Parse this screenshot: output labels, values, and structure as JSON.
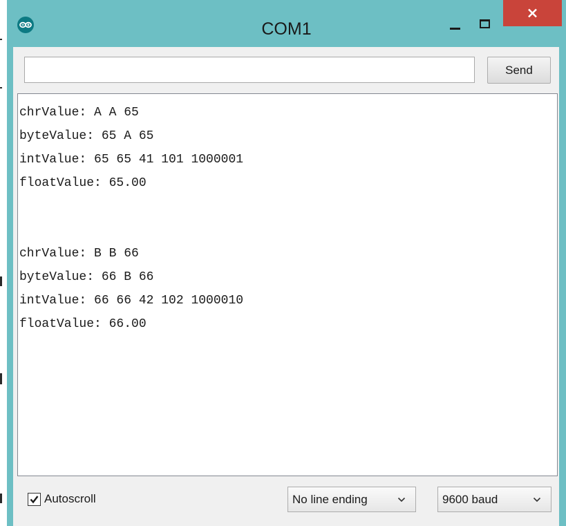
{
  "window": {
    "title": "COM1",
    "app_icon": "arduino-infinity-icon",
    "controls": [
      "minimize-icon",
      "maximize-icon",
      "close-icon"
    ],
    "accent_color": "#6dbfc4",
    "close_color": "#c9443a"
  },
  "send_bar": {
    "input_value": "",
    "send_label": "Send"
  },
  "output": {
    "lines": [
      "chrValue: A A 65",
      "byteValue: 65 A 65",
      "intValue: 65 65 41 101 1000001",
      "floatValue: 65.00",
      "",
      "",
      "chrValue: B B 66",
      "byteValue: 66 B 66",
      "intValue: 66 66 42 102 1000010",
      "floatValue: 66.00"
    ]
  },
  "bottom_bar": {
    "autoscroll_label": "Autoscroll",
    "autoscroll_checked": true,
    "line_ending": "No line ending",
    "baud_rate": "9600 baud"
  }
}
